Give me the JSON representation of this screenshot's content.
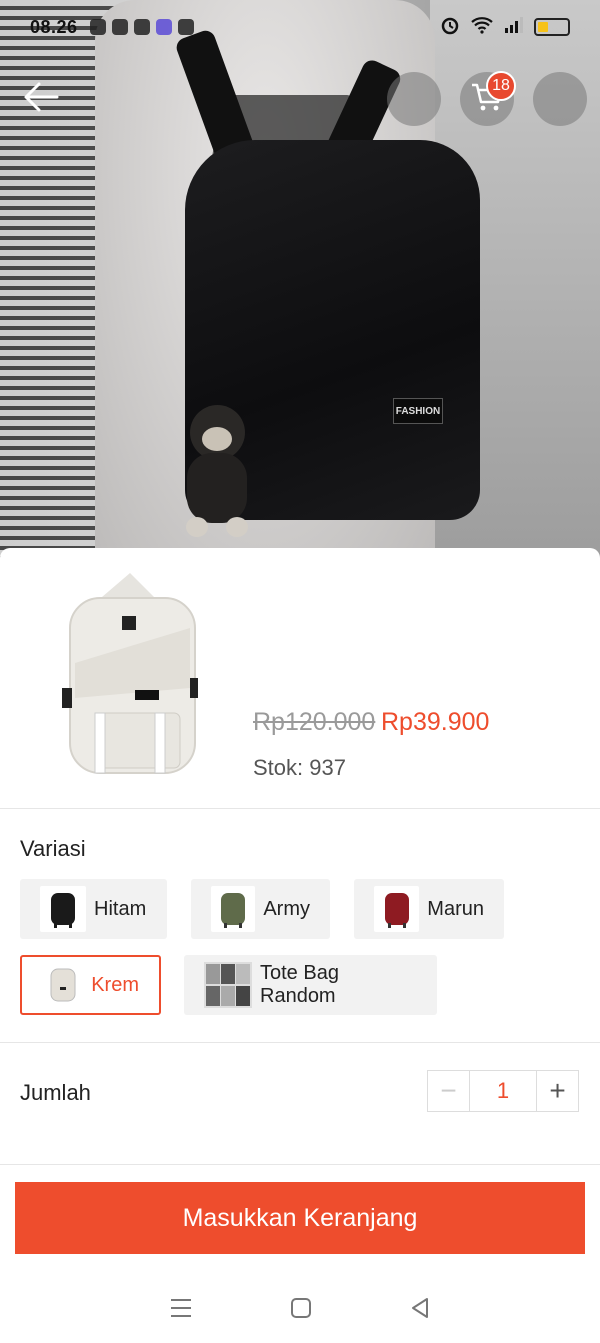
{
  "status_bar": {
    "time": "08.26",
    "battery_color": "#f6c21a"
  },
  "header": {
    "back_icon": "arrow-left-icon",
    "cart_icon": "cart-icon",
    "cart_count": "18"
  },
  "photo": {
    "bag_label": "FASHION"
  },
  "product": {
    "price_original": "Rp120.000",
    "price_discount": "Rp39.900",
    "stock": "Stok: 937"
  },
  "variation": {
    "title": "Variasi",
    "options": [
      {
        "label": "Hitam",
        "swatch": "#1a1a1a",
        "selected": false
      },
      {
        "label": "Army",
        "swatch": "#5f6b4a",
        "selected": false
      },
      {
        "label": "Marun",
        "swatch": "#8e1b22",
        "selected": false
      },
      {
        "label": "Krem",
        "swatch": "#e4e0d8",
        "selected": true
      },
      {
        "label": "Tote Bag Random",
        "swatch": "#8a8a8a",
        "selected": false
      }
    ]
  },
  "quantity": {
    "label": "Jumlah",
    "value": "1",
    "minus": "−",
    "plus": "+"
  },
  "cta": {
    "label": "Masukkan Keranjang",
    "color": "#ee4d2d"
  },
  "nav": {
    "menu_icon": "menu-icon",
    "home_icon": "home-square-icon",
    "back_icon": "back-triangle-icon"
  }
}
